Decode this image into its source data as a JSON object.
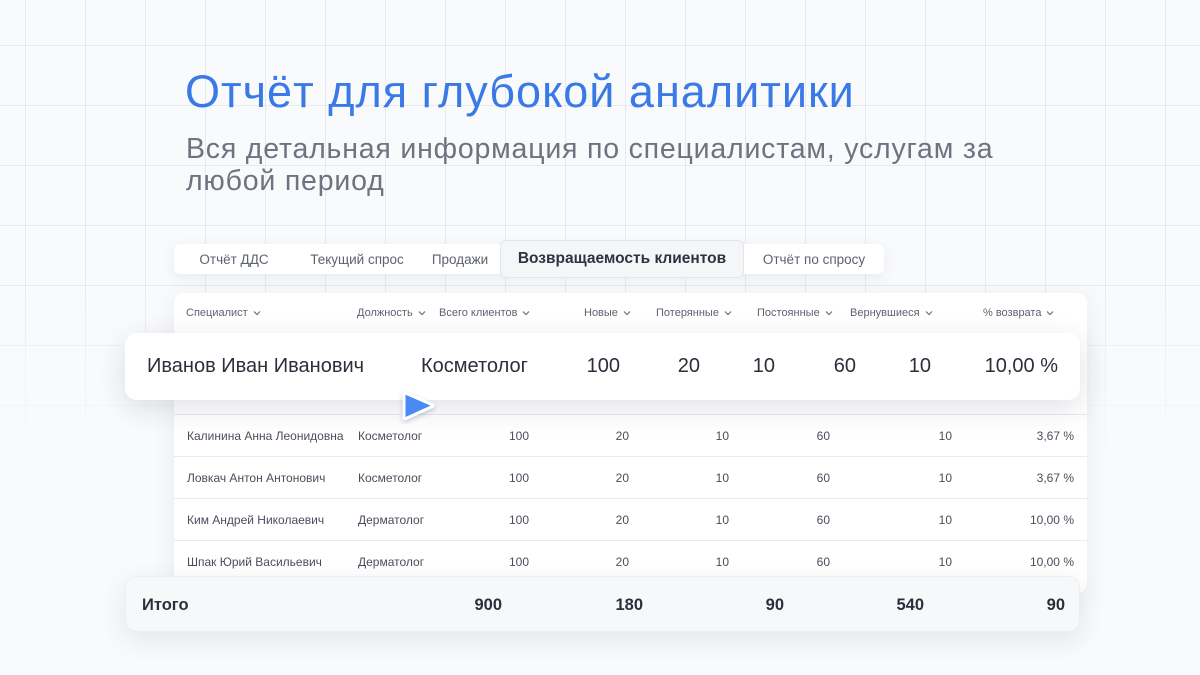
{
  "hero": {
    "title": "Отчёт для глубокой аналитики",
    "subtitle": "Вся детальная информация по специалистам, услугам за любой период"
  },
  "tabs": [
    {
      "label": "Отчёт ДДС",
      "active": false
    },
    {
      "label": "Текущий спрос",
      "active": false
    },
    {
      "label": "Продажи",
      "active": false
    },
    {
      "label": "Возвращаемость клиентов",
      "active": true
    },
    {
      "label": "Отчёт по спросу",
      "active": false
    }
  ],
  "table": {
    "columns": [
      "Специалист",
      "Должность",
      "Всего клиентов",
      "Новые",
      "Потерянные",
      "Постоянные",
      "Вернувшиеся",
      "% возврата"
    ],
    "highlight_row": [
      "Иванов Иван Иванович",
      "Косметолог",
      "100",
      "20",
      "10",
      "60",
      "10",
      "10,00 %"
    ],
    "rows": [
      [
        "Калинина Анна Леонидовна",
        "Косметолог",
        "100",
        "20",
        "10",
        "60",
        "10",
        "3,67 %"
      ],
      [
        "Ловкач Антон Антонович",
        "Косметолог",
        "100",
        "20",
        "10",
        "60",
        "10",
        "3,67 %"
      ],
      [
        "Ким Андрей Николаевич",
        "Дерматолог",
        "100",
        "20",
        "10",
        "60",
        "10",
        "10,00 %"
      ],
      [
        "Шпак Юрий Васильевич",
        "Дерматолог",
        "100",
        "20",
        "10",
        "60",
        "10",
        "10,00 %"
      ]
    ],
    "totals": {
      "label": "Итого",
      "values": [
        "900",
        "180",
        "90",
        "540",
        "90"
      ]
    }
  },
  "icons": {
    "column_sort": "chevron-down-icon",
    "pointer": "cursor-pointer-icon"
  },
  "colors": {
    "accent": "#3a7ae6",
    "subtitle": "#6f7280",
    "text": "#2b2f3a"
  }
}
